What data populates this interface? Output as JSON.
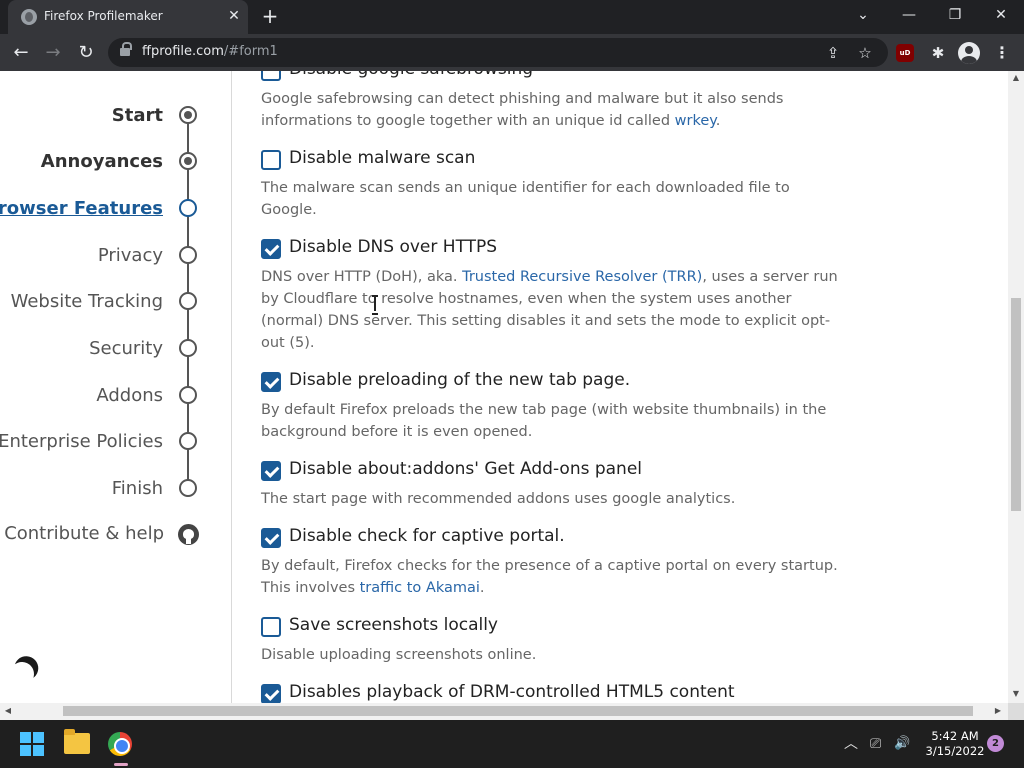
{
  "browser": {
    "tab_title": "Firefox Profilemaker",
    "tab_close": "✕",
    "new_tab": "+",
    "url_host": "ffprofile.com",
    "url_path": "/#form1",
    "win_menu": "⌄",
    "win_minimize": "—",
    "win_restore": "❐",
    "win_close": "✕",
    "back": "←",
    "forward": "→",
    "reload": "↻",
    "share": "⇪",
    "star": "☆",
    "ublock": "uD",
    "extensions": "✱",
    "menu": "⋮"
  },
  "sidebar": {
    "steps": [
      {
        "label": "Start",
        "state": "done"
      },
      {
        "label": "Annoyances",
        "state": "done"
      },
      {
        "label": "Browser Features",
        "state": "current"
      },
      {
        "label": "Privacy",
        "state": "todo"
      },
      {
        "label": "Website Tracking",
        "state": "todo"
      },
      {
        "label": "Security",
        "state": "todo"
      },
      {
        "label": "Addons",
        "state": "todo"
      },
      {
        "label": "Enterprise Policies",
        "state": "todo"
      },
      {
        "label": "Finish",
        "state": "todo"
      }
    ],
    "contribute": "Contribute & help"
  },
  "options": [
    {
      "title": "Disable google safebrowsing",
      "checked": false,
      "desc_before": "Google safebrowsing can detect phishing and malware but it also sends informations to google together with an unique id called ",
      "desc_link": "wrkey",
      "desc_after": "."
    },
    {
      "title": "Disable malware scan",
      "checked": false,
      "desc_before": "The malware scan sends an unique identifier for each downloaded file to Google.",
      "desc_link": "",
      "desc_after": ""
    },
    {
      "title": "Disable DNS over HTTPS",
      "checked": true,
      "desc_before": "DNS over HTTP (DoH), aka. ",
      "desc_link": "Trusted Recursive Resolver (TRR)",
      "desc_after": ", uses a server run by Cloudflare to resolve hostnames, even when the system uses another (normal) DNS server. This setting disables it and sets the mode to explicit opt-out (5)."
    },
    {
      "title": "Disable preloading of the new tab page.",
      "checked": true,
      "desc_before": "By default Firefox preloads the new tab page (with website thumbnails) in the background before it is even opened.",
      "desc_link": "",
      "desc_after": ""
    },
    {
      "title": "Disable about:addons' Get Add-ons panel",
      "checked": true,
      "desc_before": "The start page with recommended addons uses google analytics.",
      "desc_link": "",
      "desc_after": ""
    },
    {
      "title": "Disable check for captive portal.",
      "checked": true,
      "desc_before": "By default, Firefox checks for the presence of a captive portal on every startup. This involves ",
      "desc_link": "traffic to Akamai",
      "desc_after": "."
    },
    {
      "title": "Save screenshots locally",
      "checked": false,
      "desc_before": "Disable uploading screenshots online.",
      "desc_link": "",
      "desc_after": ""
    },
    {
      "title": "Disables playback of DRM-controlled HTML5 content",
      "checked": true,
      "desc_before": "",
      "desc_link": "",
      "desc_after": ""
    }
  ],
  "taskbar": {
    "time": "5:42 AM",
    "date": "3/15/2022",
    "notifications": "2",
    "tray_chevron": "︿",
    "tray_network": "⎚",
    "tray_volume": "🔊"
  },
  "colors": {
    "accent": "#1a5a96",
    "link": "#2a67a8"
  }
}
